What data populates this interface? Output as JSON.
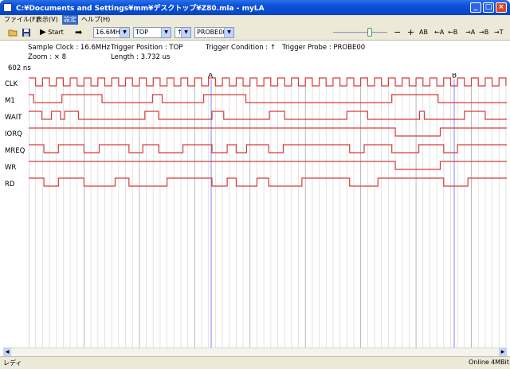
{
  "window": {
    "title": "C:¥Documents and Settings¥mm¥デスクトップ¥Z80.mla - myLA"
  },
  "menu": [
    "ファイル(F)",
    "表示(V)",
    "設定",
    "ヘルプ(H)"
  ],
  "toolbar": {
    "start_label": "Start",
    "clock": "16.6MHz",
    "trigger_position": "TOP",
    "trigger_edge": "↑",
    "trigger_probe": "PROBE00",
    "zoom_out": "−",
    "zoom_in": "+",
    "ab": "AB",
    "a_left": "←A",
    "b_left": "←B",
    "a_right": "→A",
    "b_right": "→B",
    "t_right": "→T"
  },
  "info": {
    "sample_clock": "Sample Clock : 16.6MHz",
    "trigger_position": "Trigger Position : TOP",
    "trigger_condition": "Trigger Condition :  ↑",
    "trigger_probe": "Trigger Probe : PROBE00",
    "zoom": "Zoom : ×   8",
    "length": "Length : 3.732 us",
    "time": "602 ns"
  },
  "markers": {
    "a": "A",
    "b": "B"
  },
  "channels": [
    "CLK",
    "M1",
    "WAIT",
    "IORQ",
    "MREQ",
    "WR",
    "RD"
  ],
  "status": {
    "left": "レディ",
    "online": "Online",
    "memory": "4MBit"
  },
  "colors": {
    "signal": "#d43c3c",
    "grid_major": "#a8a8a8",
    "grid_minor": "#dcdcdc",
    "marker": "#8080ff"
  },
  "signals": {
    "M1": [
      [
        0,
        0
      ],
      [
        0.7,
        1
      ],
      [
        4.8,
        0
      ],
      [
        10.6,
        1
      ],
      [
        17.9,
        0
      ],
      [
        19.3,
        1
      ],
      [
        25.3,
        0
      ],
      [
        31.4,
        1
      ],
      [
        52.5,
        0
      ],
      [
        59.2,
        1
      ]
    ],
    "WAIT": [
      [
        0,
        0
      ],
      [
        1.9,
        1
      ],
      [
        3.3,
        0
      ],
      [
        4.6,
        1
      ],
      [
        5.2,
        0
      ],
      [
        7.2,
        1
      ],
      [
        16.8,
        0
      ],
      [
        18.8,
        1
      ],
      [
        26.5,
        0
      ],
      [
        28.2,
        1
      ],
      [
        34.8,
        0
      ],
      [
        37,
        1
      ],
      [
        46,
        0
      ],
      [
        49,
        1
      ],
      [
        56.5,
        0
      ],
      [
        57.2,
        1
      ],
      [
        63,
        0
      ],
      [
        66,
        1
      ]
    ],
    "IORQ": [
      [
        0,
        0
      ],
      [
        53,
        1
      ],
      [
        59.5,
        0
      ]
    ],
    "MREQ": [
      [
        0,
        0
      ],
      [
        2.2,
        1
      ],
      [
        4.3,
        0
      ],
      [
        8,
        1
      ],
      [
        10.2,
        0
      ],
      [
        14.5,
        1
      ],
      [
        16.5,
        0
      ],
      [
        18.8,
        1
      ],
      [
        22.3,
        0
      ],
      [
        26.5,
        1
      ],
      [
        28.7,
        0
      ],
      [
        30,
        1
      ],
      [
        31.5,
        0
      ],
      [
        34.7,
        1
      ],
      [
        36.8,
        0
      ],
      [
        46.4,
        1
      ],
      [
        48.5,
        0
      ],
      [
        52.5,
        1
      ],
      [
        56.4,
        0
      ],
      [
        60,
        1
      ],
      [
        62,
        0
      ]
    ],
    "WR": [
      [
        0,
        0
      ],
      [
        53,
        1
      ],
      [
        59.5,
        0
      ]
    ],
    "RD": [
      [
        0,
        0
      ],
      [
        2.2,
        1
      ],
      [
        4.3,
        0
      ],
      [
        8,
        1
      ],
      [
        12.5,
        0
      ],
      [
        14.5,
        1
      ],
      [
        20,
        0
      ],
      [
        26.5,
        1
      ],
      [
        28.7,
        0
      ],
      [
        30,
        1
      ],
      [
        33,
        0
      ],
      [
        34.7,
        1
      ],
      [
        39.5,
        0
      ],
      [
        46.4,
        1
      ],
      [
        50.5,
        0
      ],
      [
        60,
        1
      ],
      [
        63.5,
        0
      ]
    ]
  }
}
